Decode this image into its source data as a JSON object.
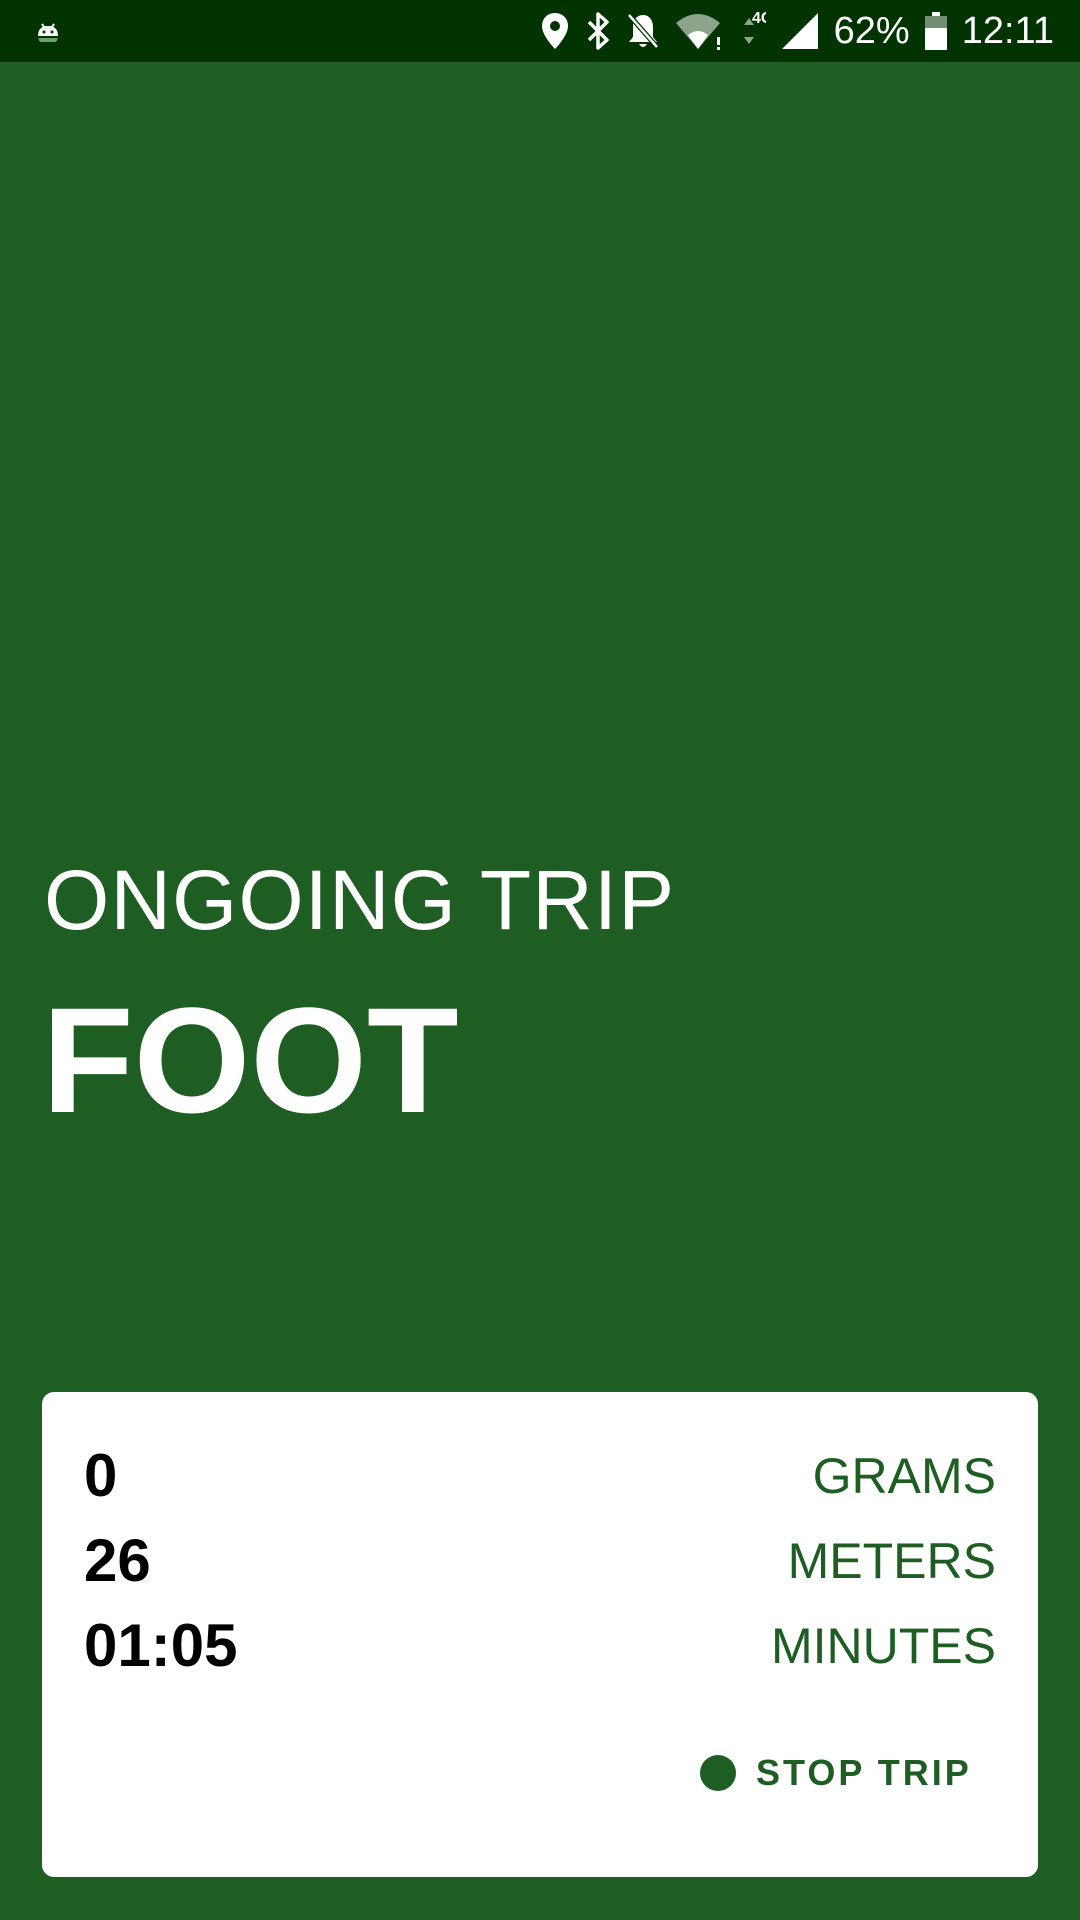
{
  "status_bar": {
    "battery_percent": "62%",
    "time": "12:11",
    "network_type": "4G",
    "icons": [
      "android-icon",
      "location-icon",
      "bluetooth-icon",
      "bell-off-icon",
      "wifi-icon",
      "data-arrows-icon",
      "signal-icon",
      "battery-icon"
    ]
  },
  "trip": {
    "status_label": "ONGOING TRIP",
    "mode": "FOOT"
  },
  "stats": [
    {
      "value": "0",
      "unit": "GRAMS"
    },
    {
      "value": "26",
      "unit": "METERS"
    },
    {
      "value": "01:05",
      "unit": "MINUTES"
    }
  ],
  "actions": {
    "stop_label": "STOP TRIP"
  },
  "colors": {
    "background": "#1e5e22",
    "status_bar": "#003300",
    "card": "#ffffff",
    "accent": "#1e5e22"
  }
}
